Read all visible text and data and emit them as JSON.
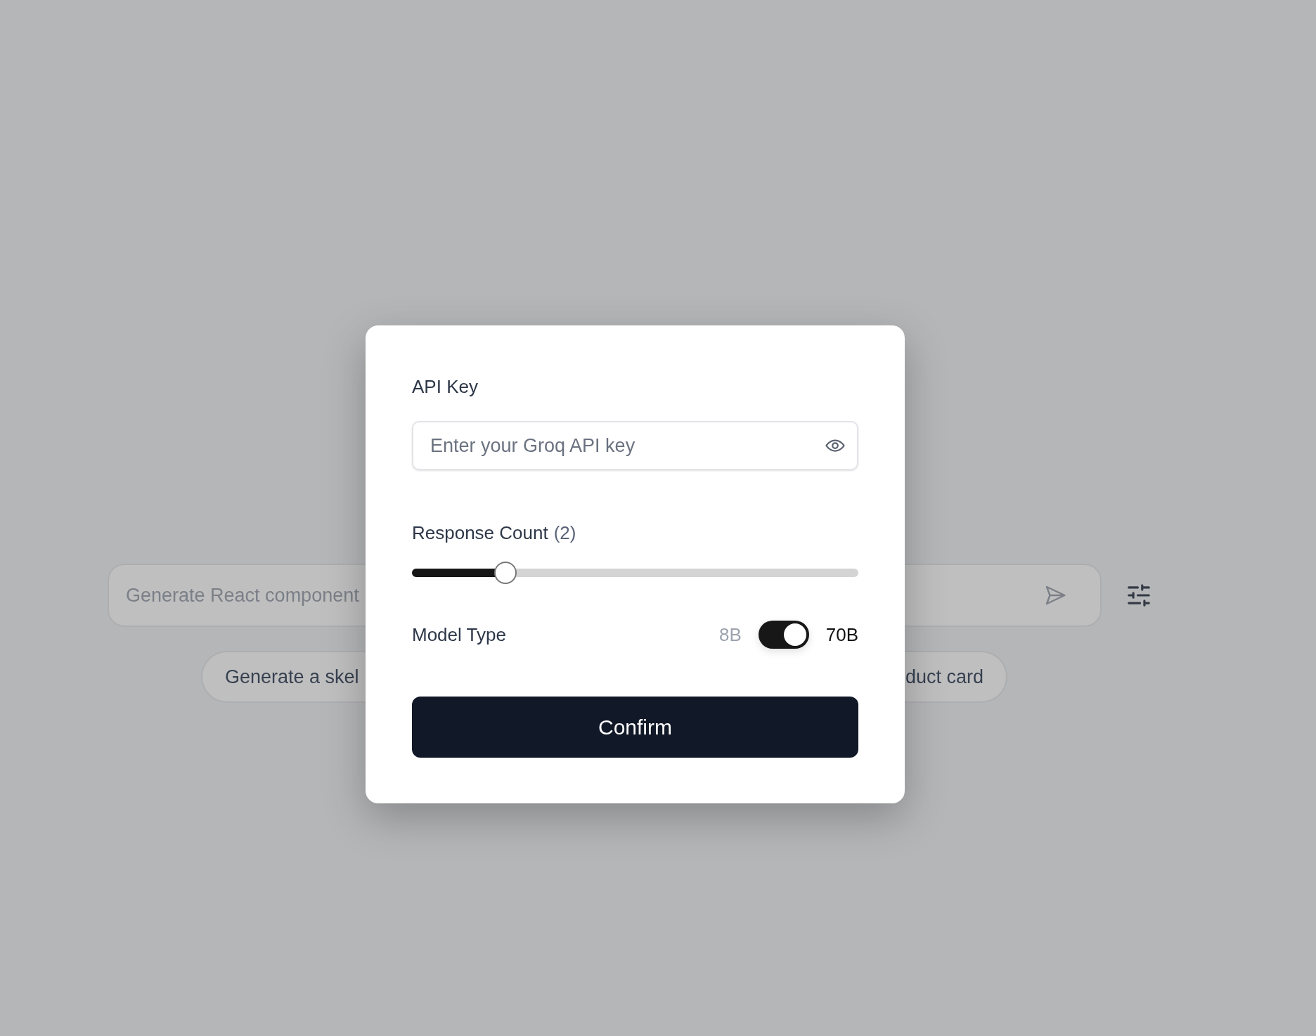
{
  "background": {
    "prompt_field": {
      "placeholder": "Generate React component"
    },
    "suggestions": [
      "Generate a skel",
      "duct card"
    ]
  },
  "dialog": {
    "api_key": {
      "label": "API Key",
      "placeholder": "Enter your Groq API key"
    },
    "response_count": {
      "label": "Response Count",
      "value": "(2)",
      "level": 0.21
    },
    "model_type": {
      "label": "Model Type",
      "off_label": "8B",
      "on_label": "70B",
      "on": true
    },
    "confirm": "Confirm"
  }
}
